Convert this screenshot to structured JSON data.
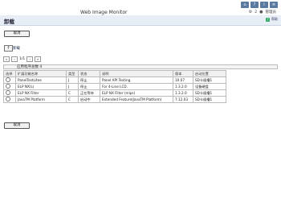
{
  "app": {
    "title": "Web Image Monitor"
  },
  "header": {
    "icons": [
      "home-icon",
      "question-icon",
      "info-icon",
      "menu-icon"
    ],
    "user_label": "管理员",
    "user_flag": "2",
    "page_title": "卸载",
    "help_label": "帮助"
  },
  "toolbar": {
    "top_button": "取消",
    "bottom_button": "取消"
  },
  "upload": {
    "icon": "↑",
    "label": "卸载"
  },
  "pager": {
    "page_text": "1/1"
  },
  "list": {
    "count_text": "应用程序总数 4",
    "columns": [
      "选择",
      "扩展功能名称",
      "类型",
      "状态",
      "说明",
      "版本",
      "启动位置"
    ],
    "rows": [
      [
        "",
        "PanelTestLitee",
        "J",
        "停止",
        "Panel API Testing.",
        "10.07",
        "SD卡插槽1"
      ],
      [
        "",
        "ELP NX(L)",
        "J",
        "停止",
        "For 4-Line LCD.",
        "1.3.2.0",
        "设备硬盘"
      ],
      [
        "",
        "ELP NX Filter",
        "C",
        "正在等待",
        "ELP NX Filter (mips)",
        "1.3.2.0",
        "SD卡插槽1"
      ],
      [
        "",
        "JavaTM Platform",
        "C",
        "启动中",
        "Extended Feature(JavaTM Platform)",
        "7.12.03",
        "SD卡插槽1"
      ]
    ]
  }
}
